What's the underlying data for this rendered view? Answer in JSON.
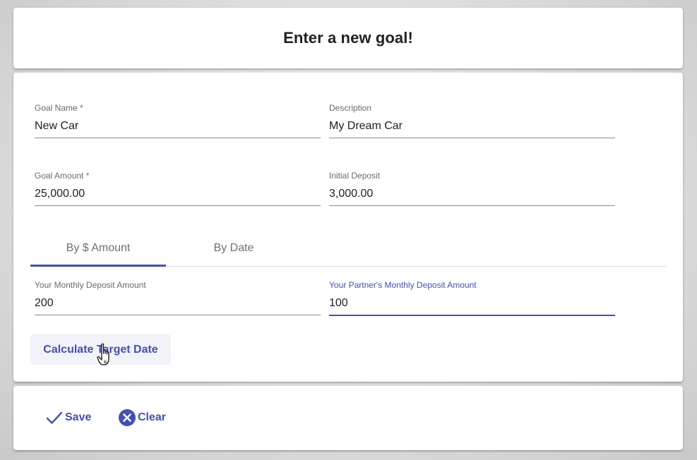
{
  "header": {
    "title": "Enter a new goal!"
  },
  "form": {
    "goal_name": {
      "label": "Goal Name *",
      "value": "New Car"
    },
    "description": {
      "label": "Description",
      "value": "My Dream Car"
    },
    "goal_amount": {
      "label": "Goal Amount *",
      "value": "25,000.00"
    },
    "initial_deposit": {
      "label": "Initial Deposit",
      "value": "3,000.00"
    }
  },
  "tabs": [
    {
      "label": "By $ Amount",
      "active": true
    },
    {
      "label": "By Date",
      "active": false
    }
  ],
  "deposit": {
    "monthly": {
      "label": "Your Monthly Deposit Amount",
      "value": "200"
    },
    "partner_monthly": {
      "label": "Your Partner's Monthly Deposit Amount",
      "value": "100"
    }
  },
  "calculate_button": {
    "label": "Calculate Target Date"
  },
  "footer": {
    "save_label": "Save",
    "clear_label": "Clear"
  },
  "icons": {
    "save": "check-icon",
    "clear": "close-circle-icon",
    "cursor": "hand-pointer-icon"
  },
  "colors": {
    "primary": "#3f51b5",
    "text": "#212121",
    "label": "#6b6b6b",
    "button_bg": "#f2f3f9"
  }
}
